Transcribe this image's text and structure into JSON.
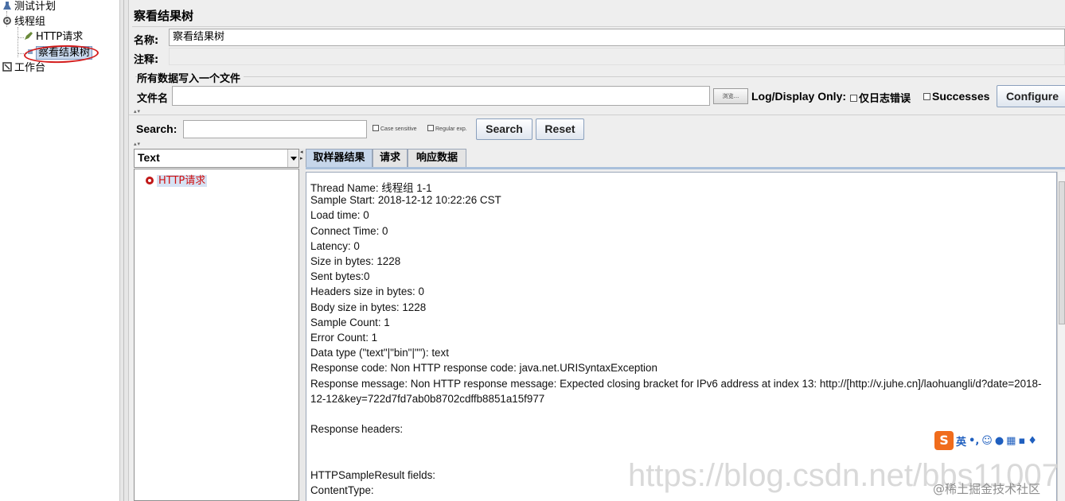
{
  "tree": {
    "root_label": "测试计划",
    "thread_group_label": "线程组",
    "http_request_label": "HTTP请求",
    "listener_label": "察看结果树",
    "workbench_label": "工作台"
  },
  "panel": {
    "title": "察看结果树",
    "name_label": "名称:",
    "name_value": "察看结果树",
    "comment_label": "注释:",
    "comment_value": "",
    "file_group_title": "所有数据写入一个文件",
    "filename_label": "文件名",
    "filename_value": "",
    "browse_label": "浏览...",
    "log_display_label": "Log/Display Only:",
    "errors_only_label": "仅日志错误",
    "successes_label": "Successes",
    "configure_label": "Configure"
  },
  "search": {
    "label": "Search:",
    "value": "",
    "case_sensitive_label": "Case sensitive",
    "regex_label": "Regular exp.",
    "search_button": "Search",
    "reset_button": "Reset"
  },
  "results": {
    "renderer_selected": "Text",
    "items": [
      "HTTP请求"
    ],
    "tabs": [
      "取样器结果",
      "请求",
      "响应数据"
    ],
    "active_tab": "取样器结果",
    "detail_lines": [
      "Thread Name: 线程组 1-1",
      "Sample Start: 2018-12-12 10:22:26 CST",
      "Load time: 0",
      "Connect Time: 0",
      "Latency: 0",
      "Size in bytes: 1228",
      "Sent bytes:0",
      "Headers size in bytes: 0",
      "Body size in bytes: 1228",
      "Sample Count: 1",
      "Error Count: 1",
      "Data type (\"text\"|\"bin\"|\"\"): text",
      "Response code: Non HTTP response code: java.net.URISyntaxException",
      "Response message: Non HTTP response message: Expected closing bracket for IPv6 address at index 13: http://[http://v.juhe.cn]/laohuangli/d?date=2018-",
      "12-12&key=722d7fd7ab0b8702cdffb8851a15f977",
      "",
      "Response headers:",
      "",
      "",
      "HTTPSampleResult fields:",
      "ContentType:"
    ]
  },
  "overlay": {
    "ime_label": "英",
    "watermark_url": "https://blog.csdn.net/bbs11007",
    "watermark_site": "@稀土掘金技术社区"
  },
  "colors": {
    "annotation_red": "#d41e1e",
    "error_red": "#d01010",
    "selection_blue": "#c9d9ee"
  }
}
